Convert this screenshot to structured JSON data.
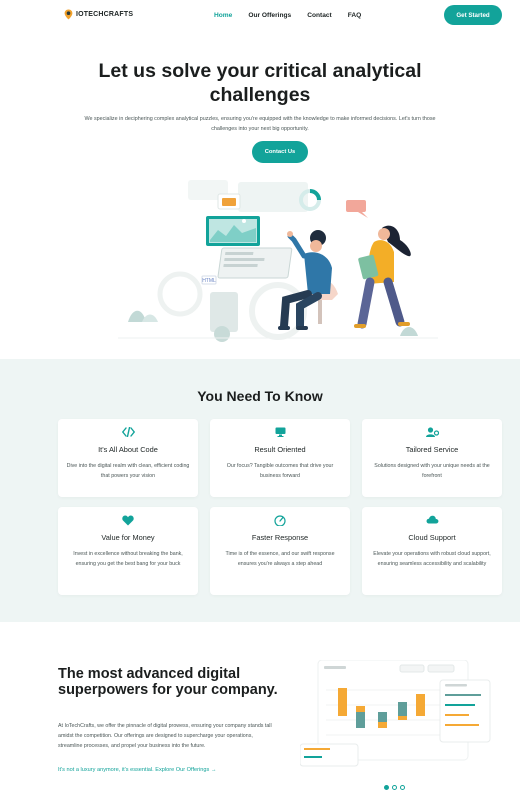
{
  "brand": {
    "name": "IOTECHCRAFTS"
  },
  "nav": {
    "items": [
      {
        "label": "Home",
        "active": true
      },
      {
        "label": "Our Offerings",
        "active": false
      },
      {
        "label": "Contact",
        "active": false
      },
      {
        "label": "FAQ",
        "active": false
      }
    ],
    "cta": "Get Started"
  },
  "hero": {
    "title": "Let us solve your critical analytical challenges",
    "text": "We specialize in deciphering complex analytical puzzles, ensuring you're equipped with the knowledge to make informed decisions. Let's turn those challenges into your next big opportunity.",
    "button": "Contact Us"
  },
  "know": {
    "title": "You Need To Know",
    "cards": [
      {
        "icon": "code-icon",
        "title": "It's All About Code",
        "desc": "Dive into the digital realm with clean, efficient coding that powers your vision"
      },
      {
        "icon": "monitor-icon",
        "title": "Result Oriented",
        "desc": "Our focus? Tangible outcomes that drive your business forward"
      },
      {
        "icon": "user-gear-icon",
        "title": "Tailored Service",
        "desc": "Solutions designed with your unique needs at the forefront"
      },
      {
        "icon": "heart-icon",
        "title": "Value for Money",
        "desc": "Invest in excellence without breaking the bank, ensuring you get the best bang for your buck"
      },
      {
        "icon": "speedometer-icon",
        "title": "Faster Response",
        "desc": "Time is of the essence, and our swift response ensures you're always a step ahead"
      },
      {
        "icon": "cloud-icon",
        "title": "Cloud Support",
        "desc": "Elevate your operations with robust cloud support, ensuring seamless accessibility and scalability"
      }
    ]
  },
  "advanced": {
    "title": "The most advanced digital superpowers for your company.",
    "text": "At IoTechCrafts, we offer the pinnacle of digital prowess, ensuring your company stands tall amidst the competition. Our offerings are designed to supercharge your operations, streamline processes, and propel your business into the future.",
    "link": "It's not a luxury anymore, it's essential. Explore Our Offerings"
  },
  "colors": {
    "accent": "#12a39a",
    "section_bg": "#eef5f4"
  },
  "carousel": {
    "count": 3,
    "active": 1
  }
}
